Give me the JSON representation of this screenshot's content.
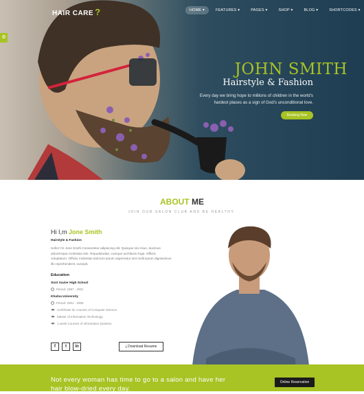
{
  "brand": {
    "name": "HAIR CARE",
    "mark": "?"
  },
  "nav": {
    "items": [
      "HOME ▾",
      "FEATURES ▾",
      "PAGES ▾",
      "SHOP ▾",
      "BLOG ▾",
      "SHORTCODES ▾"
    ],
    "active": 0
  },
  "side_tab": {
    "icon": "settings-icon",
    "label": "⚙"
  },
  "hero": {
    "title": "JOHN SMITH",
    "subtitle": "Hairstyle & Fashion",
    "description": "Every day we bring hope to millions of children in the world's hardest places as a sign of God's unconditional love.",
    "button": "Booking Now"
  },
  "about": {
    "title_highlight": "ABOUT",
    "title_rest": " ME",
    "tagline": "JOIN OUR SALON CLUB AND BE HEALTHY.",
    "greeting": "Hi I,m ",
    "name": "Jone Smith",
    "role": "Hairstyle & Fashion",
    "bio": "Hello! I'm Jone Smith.Consectetur adipiscing elit. Quisque nisi risus. ducimus doloremque molestias iste. Repudiandae, cumque architecto fuga. Officiis voluptatum. Officiis molestias dolorum ipsum aspernatur sint molli ipsum dignissimos illo reprehenderit, suscipit.",
    "education_heading": "Education",
    "schools": [
      {
        "name": "Sont Xavier High School",
        "period": "Period: 1997 - 2001"
      },
      {
        "name": "Khulna University",
        "period": "Period: 2001 - 2009"
      }
    ],
    "certs": [
      "Certificate for courses of Computer Science.",
      "Master of Information Technology.",
      "1 week Courses of Information Systems."
    ],
    "socials": [
      "f",
      "t",
      "in"
    ],
    "download_button": "⤓ Download Resume"
  },
  "band": {
    "text": "Not every woman has time to go to a salon and have her hair blow-dried every day.",
    "button": "Online Reservation"
  },
  "colors": {
    "accent": "#a8c324",
    "dark": "#1b1b1b"
  }
}
